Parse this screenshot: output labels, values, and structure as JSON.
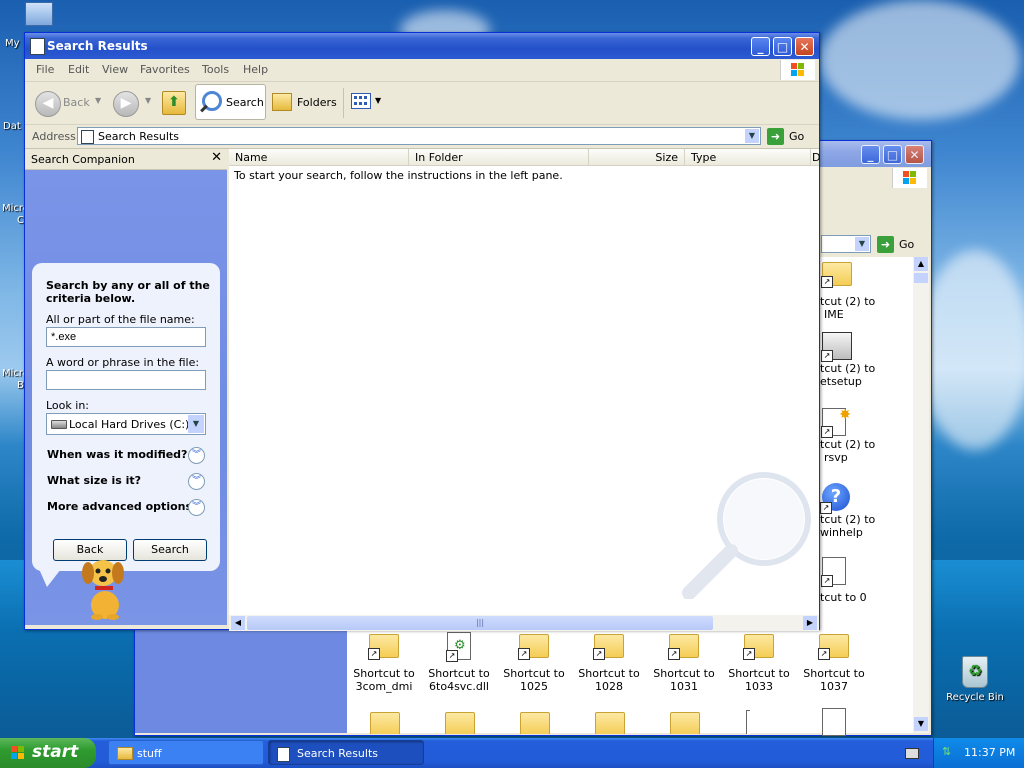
{
  "desktop": {
    "icons": [
      {
        "label": "My",
        "icon": "computer-icon"
      },
      {
        "label": "Dat",
        "icon": "folder-icon"
      },
      {
        "label": "Micro",
        "icon": "app-icon"
      },
      {
        "label": "Micro",
        "icon": "app-icon"
      },
      {
        "label": "Recycle Bin",
        "icon": "recycle-bin-icon"
      }
    ],
    "partial_labels": [
      "C",
      "B"
    ]
  },
  "search_window": {
    "title": "Search Results",
    "menu": [
      "File",
      "Edit",
      "View",
      "Favorites",
      "Tools",
      "Help"
    ],
    "toolbar": {
      "back": "Back",
      "search": "Search",
      "folders": "Folders"
    },
    "address": {
      "label": "Address",
      "value": "Search Results",
      "go": "Go"
    },
    "companion": {
      "title": "Search Companion",
      "heading": "Search by any or all of the criteria below.",
      "file_name_label": "All or part of the file name:",
      "file_name_value": "*.exe",
      "phrase_label": "A word or phrase in the file:",
      "phrase_value": "",
      "look_in_label": "Look in:",
      "look_in_value": "Local Hard Drives (C:)",
      "options": [
        "When was it modified?",
        "What size is it?",
        "More advanced options"
      ],
      "back_button": "Back",
      "search_button": "Search"
    },
    "columns": [
      "Name",
      "In Folder",
      "Size",
      "Type",
      "D"
    ],
    "empty_message": "To start your search, follow the instructions in the left pane."
  },
  "stuff_window": {
    "go": "Go",
    "right_items": [
      {
        "line1": "tcut (2) to",
        "line2": "IME",
        "icon": "folder-icon"
      },
      {
        "line1": "tcut (2) to",
        "line2": "etsetup",
        "icon": "setup-icon"
      },
      {
        "line1": "tcut (2) to",
        "line2": "rsvp",
        "icon": "document-icon"
      },
      {
        "line1": "tcut (2) to",
        "line2": "winhelp",
        "icon": "help-icon"
      },
      {
        "line1": "tcut to 0",
        "line2": "",
        "icon": "document-icon"
      }
    ],
    "bottom_items": [
      {
        "line1": "Shortcut to",
        "line2": "3com_dmi"
      },
      {
        "line1": "Shortcut to",
        "line2": "6to4svc.dll"
      },
      {
        "line1": "Shortcut to",
        "line2": "1025"
      },
      {
        "line1": "Shortcut to",
        "line2": "1028"
      },
      {
        "line1": "Shortcut to",
        "line2": "1031"
      },
      {
        "line1": "Shortcut to",
        "line2": "1033"
      },
      {
        "line1": "Shortcut to",
        "line2": "1037"
      }
    ]
  },
  "taskbar": {
    "start": "start",
    "tasks": [
      "stuff",
      "Search Results"
    ],
    "clock": "11:37 PM"
  }
}
